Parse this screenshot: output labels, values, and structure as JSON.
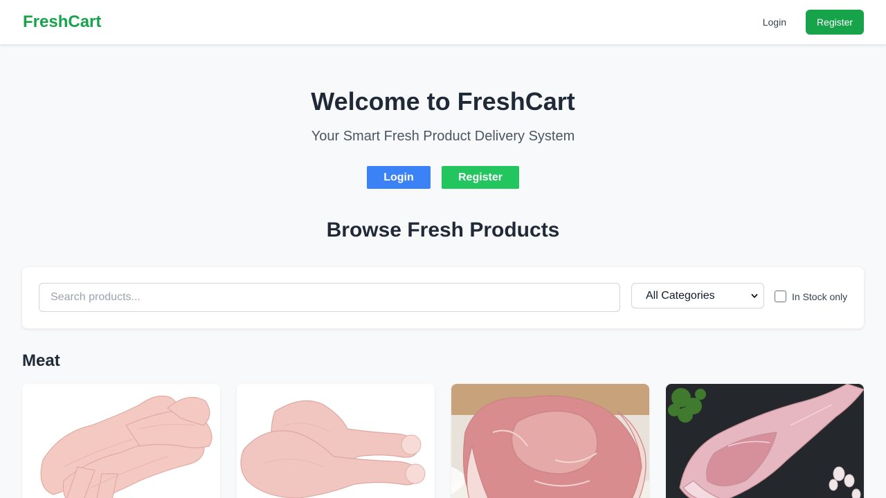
{
  "nav": {
    "brand": "FreshCart",
    "login": "Login",
    "register": "Register"
  },
  "hero": {
    "title": "Welcome to FreshCart",
    "subtitle": "Your Smart Fresh Product Delivery System",
    "login_button": "Login",
    "register_button": "Register"
  },
  "browse": {
    "title": "Browse Fresh Products",
    "search_placeholder": "Search products...",
    "category_selected": "All Categories",
    "in_stock_label": "In Stock only",
    "in_stock_checked": false
  },
  "sections": [
    {
      "heading": "Meat",
      "products": [
        {
          "image": "chicken-wings"
        },
        {
          "image": "chicken-drumsticks"
        },
        {
          "image": "pork-shoulder"
        },
        {
          "image": "lamb-leg"
        }
      ]
    }
  ],
  "colors": {
    "brand_green": "#16a34a",
    "hero_login_blue": "#3b82f6",
    "hero_register_green": "#22c55e",
    "page_background": "#f8f9fa"
  }
}
